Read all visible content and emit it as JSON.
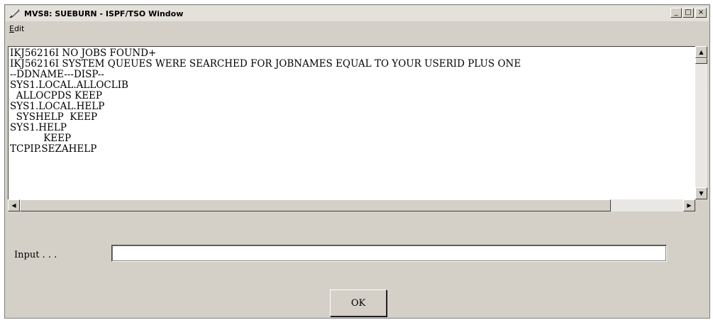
{
  "window": {
    "title": "MVS8: SUEBURN - ISPF/TSO Window",
    "minimize_glyph": "_",
    "maximize_glyph": "□",
    "close_glyph": "×"
  },
  "menubar": {
    "items": [
      {
        "label_first": "E",
        "label_rest": "dit"
      }
    ]
  },
  "output": {
    "lines": [
      "IKJ56216I NO JOBS FOUND+",
      "IKJ56216I SYSTEM QUEUES WERE SEARCHED FOR JOBNAMES EQUAL TO YOUR USERID PLUS ONE",
      "--DDNAME---DISP--",
      "SYS1.LOCAL.ALLOCLIB",
      "  ALLOCPDS KEEP",
      "SYS1.LOCAL.HELP",
      "  SYSHELP  KEEP",
      "SYS1.HELP",
      "           KEEP",
      "TCPIP.SEZAHELP"
    ]
  },
  "scrollbars": {
    "up_glyph": "▲",
    "down_glyph": "▼",
    "left_glyph": "◀",
    "right_glyph": "▶"
  },
  "form": {
    "input_label": "Input . . .",
    "input_value": "",
    "ok_label": "OK"
  },
  "colors": {
    "chrome": "#d4d0c8",
    "panel": "#ffffff",
    "text": "#000000"
  },
  "icons": {
    "app": "feather-quill-icon"
  }
}
